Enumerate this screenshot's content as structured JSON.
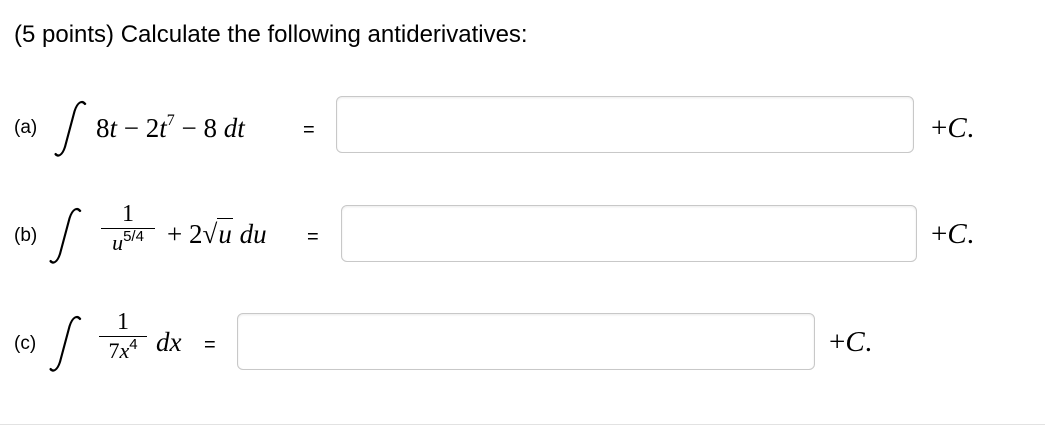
{
  "title": "(5 points) Calculate the following antiderivatives:",
  "parts": [
    {
      "label": "(a)",
      "integrand_a": "8",
      "var_t1": "t",
      "minus1": " − 2",
      "var_t2": "t",
      "exp": "7",
      "tail": " − 8 ",
      "differential": "dt",
      "equals": "=",
      "answer_value": "",
      "plus_c": "+",
      "c": "C",
      "dot": "."
    },
    {
      "label": "(b)",
      "numerator": "1",
      "den_var": "u",
      "den_exp": "5/4",
      "mid": "+ 2",
      "radical": "√",
      "radicand": "u",
      "differential": "du",
      "equals": "=",
      "answer_value": "",
      "plus_c": "+",
      "c": "C",
      "dot": "."
    },
    {
      "label": "(c)",
      "numerator": "1",
      "den_coef": "7",
      "den_var": "x",
      "den_exp": "4",
      "differential": "dx",
      "equals": "=",
      "answer_value": "",
      "plus_c": "+",
      "c": "C",
      "dot": "."
    }
  ],
  "integral_symbol": "∫"
}
